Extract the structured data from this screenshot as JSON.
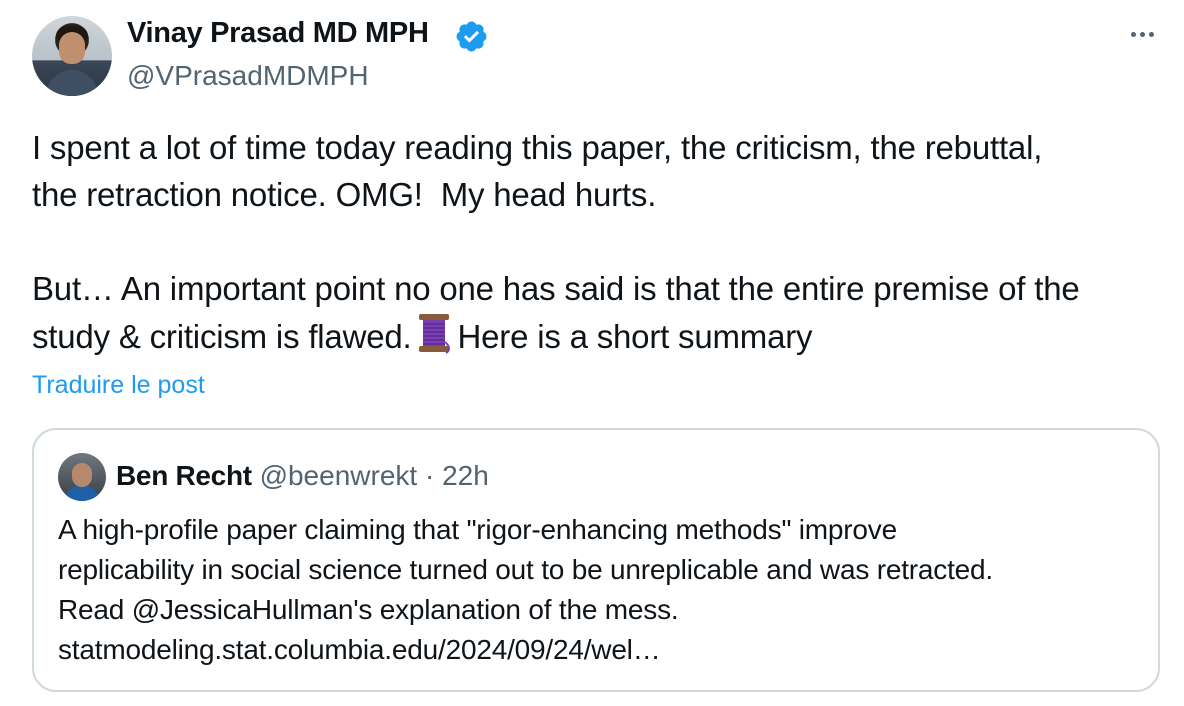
{
  "author": {
    "name": "Vinay Prasad MD MPH",
    "handle": "@VPrasadMDMPH",
    "verified_color": "#1d9bf0"
  },
  "more_icon": "more-horizontal-icon",
  "tweet": {
    "paragraph1": "I spent a lot of time today reading this paper, the criticism, the rebuttal,\nthe retraction notice. OMG!  My head hurts.",
    "paragraph2_part1": "But… An important point no one has said is that the entire premise of the\nstudy & criticism is flawed.",
    "emoji": "thread-spool-icon",
    "paragraph2_part2": "Here is a short summary",
    "translate_label": "Traduire le post"
  },
  "quote": {
    "name": "Ben Recht",
    "handle": "@beenwrekt",
    "separator": "·",
    "time": "22h",
    "lines": [
      "A high-profile paper claiming that \"rigor-enhancing methods\" improve",
      "replicability in social science turned out to be unreplicable and was retracted.",
      "Read @JessicaHullman's explanation of the mess.",
      "statmodeling.stat.columbia.edu/2024/09/24/wel…"
    ]
  },
  "colors": {
    "text": "#0f1419",
    "secondary": "#536471",
    "link": "#1d9bf0",
    "border": "#cfd9de"
  }
}
